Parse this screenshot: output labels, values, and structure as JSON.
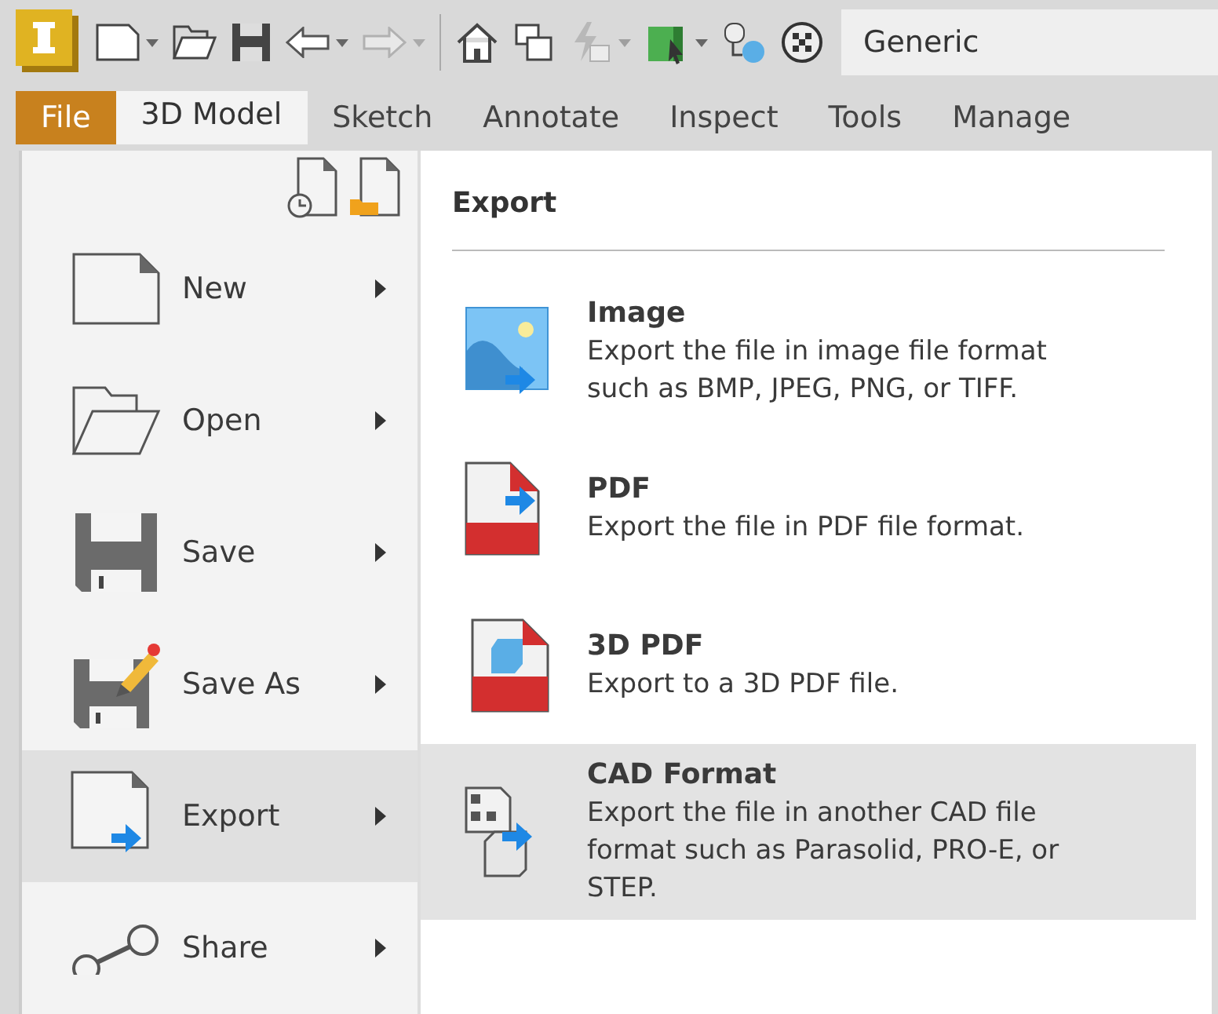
{
  "toolbar": {
    "appearance": "Generic"
  },
  "tabs": [
    {
      "label": "File",
      "selected": true,
      "current": false
    },
    {
      "label": "3D Model",
      "selected": false,
      "current": true
    },
    {
      "label": "Sketch",
      "selected": false,
      "current": false
    },
    {
      "label": "Annotate",
      "selected": false,
      "current": false
    },
    {
      "label": "Inspect",
      "selected": false,
      "current": false
    },
    {
      "label": "Tools",
      "selected": false,
      "current": false
    },
    {
      "label": "Manage",
      "selected": false,
      "current": false
    }
  ],
  "file_menu": {
    "items": [
      {
        "kind": "new",
        "label": "New",
        "selected": false
      },
      {
        "kind": "open",
        "label": "Open",
        "selected": false
      },
      {
        "kind": "save",
        "label": "Save",
        "selected": false
      },
      {
        "kind": "saveas",
        "label": "Save As",
        "selected": false
      },
      {
        "kind": "export",
        "label": "Export",
        "selected": true
      },
      {
        "kind": "share",
        "label": "Share",
        "selected": false
      }
    ]
  },
  "submenu": {
    "title": "Export",
    "items": [
      {
        "kind": "image",
        "title": "Image",
        "description": "Export the file in image file format such as BMP, JPEG, PNG, or TIFF.",
        "selected": false
      },
      {
        "kind": "pdf",
        "title": "PDF",
        "description": "Export the file in PDF file format.",
        "selected": false
      },
      {
        "kind": "pdf3d",
        "title": "3D PDF",
        "description": "Export to a 3D PDF file.",
        "selected": false
      },
      {
        "kind": "cad",
        "title": "CAD Format",
        "description": "Export the file in another CAD file format such as Parasolid, PRO-E, or STEP.",
        "selected": true
      }
    ]
  }
}
